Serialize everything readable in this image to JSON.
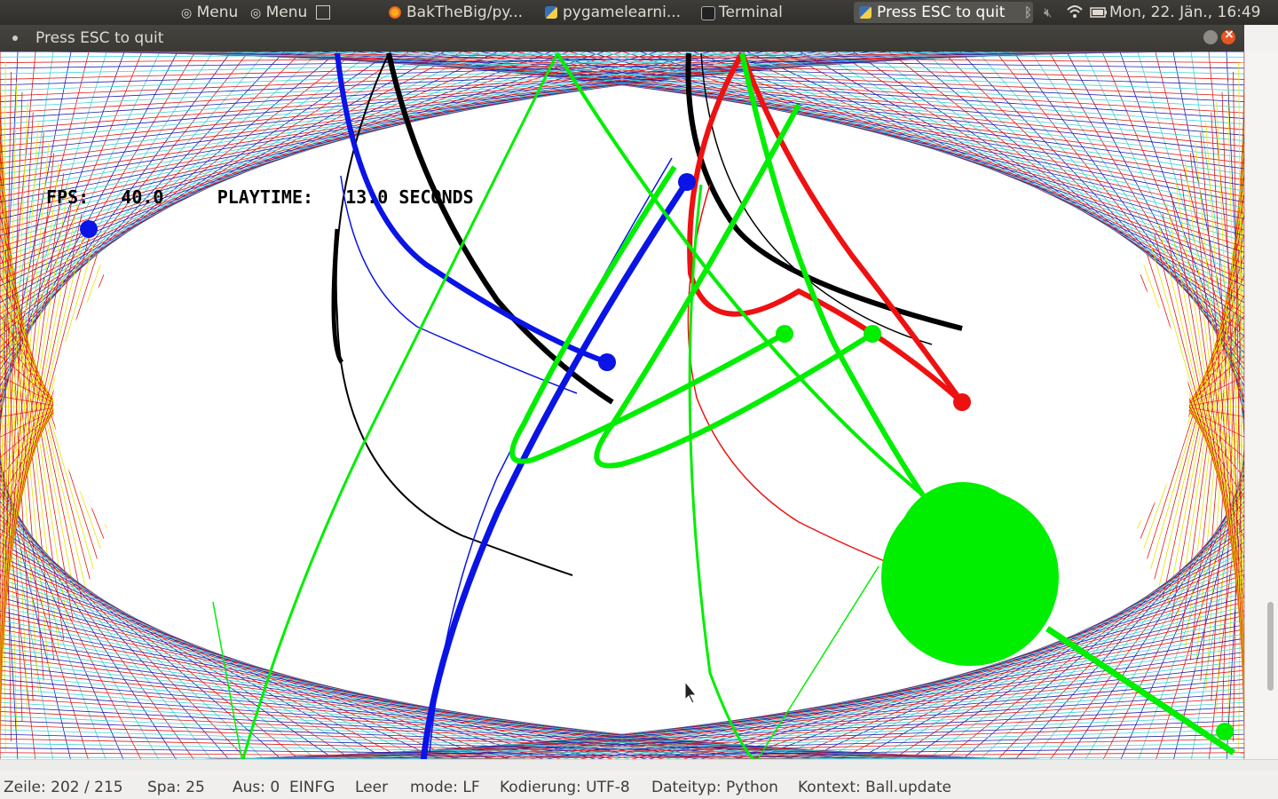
{
  "topbar": {
    "menu1": "Menu",
    "menu2": "Menu",
    "tasks": [
      {
        "label": "BakTheBig/py..."
      },
      {
        "label": "pygamelearni..."
      },
      {
        "label": "Terminal"
      },
      {
        "label": "Press ESC to quit"
      }
    ],
    "clock": "Mon, 22. Jän., 16:49"
  },
  "window": {
    "title": "Press ESC to quit"
  },
  "hud": {
    "fps_label": "FPS:",
    "fps_value": "40.0",
    "playtime_label": "PLAYTIME:",
    "playtime_value": "13.0",
    "playtime_unit": "SECONDS"
  },
  "colors": {
    "green": "#00ee00",
    "blue": "#0a14e6",
    "red": "#ee1111",
    "black": "#000000",
    "cyan": "#3fd2d2",
    "yellow": "#e6e600",
    "wire_red": "#e01818",
    "wire_blue": "#2020b0"
  },
  "statusbar": {
    "line": "Zeile: 202 / 215",
    "col": "Spa: 25",
    "sel": "Aus: 0",
    "mode_ins": "EINFG",
    "space": "Leer",
    "eol": "mode: LF",
    "encoding": "Kodierung: UTF-8",
    "filetype": "Dateityp: Python",
    "context": "Kontext: Ball.update"
  },
  "icons": {
    "menu": "menu-swirl-icon",
    "firefox": "firefox-icon",
    "python": "python-icon",
    "terminal": "terminal-icon",
    "bluetooth": "bluetooth-icon",
    "volume": "volume-muted-icon",
    "wifi": "wifi-icon",
    "battery": "battery-icon"
  }
}
